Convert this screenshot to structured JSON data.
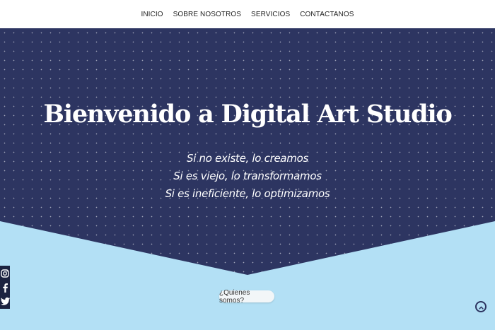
{
  "nav": {
    "items": [
      "INICIO",
      "SOBRE NOSOTROS",
      "SERVICIOS",
      "CONTACTANOS"
    ]
  },
  "hero": {
    "title": "Bienvenido a Digital Art Studio",
    "taglines": [
      "Si no existe, lo creamos",
      "Si es viejo, lo transformamos",
      "Si es ineficiente, lo optimizamos"
    ]
  },
  "about_button": {
    "label": "¿Quienes somos?"
  },
  "social": {
    "icons": [
      "instagram-icon",
      "facebook-icon",
      "twitter-icon"
    ]
  },
  "scroll_top": {
    "icon": "chevron-up-icon"
  },
  "colors": {
    "hero_bg": "#2d3561",
    "page_bg": "#b3e0f5",
    "social_bg": "#1c2340"
  }
}
